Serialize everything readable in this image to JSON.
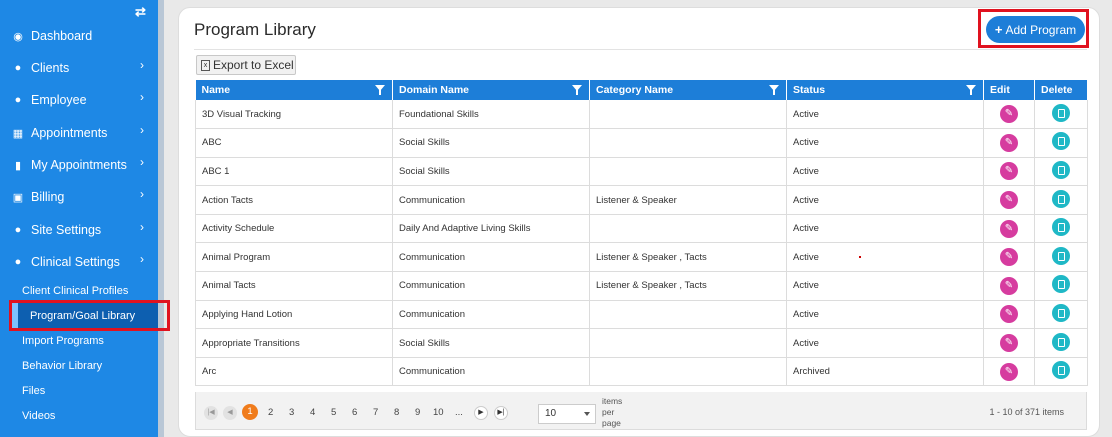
{
  "sidebar": {
    "items": [
      {
        "label": "Dashboard",
        "icon": "dashboard-icon",
        "glyph": "◉",
        "chevron": false
      },
      {
        "label": "Clients",
        "icon": "user-icon",
        "glyph": "●",
        "chevron": true
      },
      {
        "label": "Employee",
        "icon": "users-icon",
        "glyph": "●",
        "chevron": true
      },
      {
        "label": "Appointments",
        "icon": "calendar-icon",
        "glyph": "▦",
        "chevron": true
      },
      {
        "label": "My Appointments",
        "icon": "building-icon",
        "glyph": "▮",
        "chevron": true
      },
      {
        "label": "Billing",
        "icon": "money-icon",
        "glyph": "▣",
        "chevron": true
      },
      {
        "label": "Site Settings",
        "icon": "user-icon",
        "glyph": "●",
        "chevron": true
      },
      {
        "label": "Clinical Settings",
        "icon": "user-icon",
        "glyph": "●",
        "chevron": true
      }
    ],
    "sub_items": [
      "Client Clinical Profiles",
      "Program/Goal Library",
      "Import Programs",
      "Behavior Library",
      "Files",
      "Videos"
    ],
    "active_sub": "Program/Goal Library"
  },
  "header": {
    "title": "Program Library",
    "add_button": "Add Program",
    "export_button": "Export to Excel"
  },
  "table": {
    "columns": [
      "Name",
      "Domain Name",
      "Category Name",
      "Status",
      "Edit",
      "Delete"
    ],
    "rows": [
      {
        "name": "3D Visual Tracking",
        "domain": "Foundational Skills",
        "category": "",
        "status": "Active"
      },
      {
        "name": "ABC",
        "domain": "Social Skills",
        "category": "",
        "status": "Active"
      },
      {
        "name": "ABC 1",
        "domain": "Social Skills",
        "category": "",
        "status": "Active"
      },
      {
        "name": "Action Tacts",
        "domain": "Communication",
        "category": "Listener & Speaker",
        "status": "Active"
      },
      {
        "name": "Activity Schedule",
        "domain": "Daily And Adaptive Living Skills",
        "category": "",
        "status": "Active"
      },
      {
        "name": "Animal Program",
        "domain": "Communication",
        "category": "Listener & Speaker , Tacts",
        "status": "Active"
      },
      {
        "name": "Animal Tacts",
        "domain": "Communication",
        "category": "Listener & Speaker , Tacts",
        "status": "Active"
      },
      {
        "name": "Applying Hand Lotion",
        "domain": "Communication",
        "category": "",
        "status": "Active"
      },
      {
        "name": "Appropriate Transitions",
        "domain": "Social Skills",
        "category": "",
        "status": "Active"
      },
      {
        "name": "Arc",
        "domain": "Communication",
        "category": "",
        "status": "Archived"
      }
    ]
  },
  "pager": {
    "current": "1",
    "pages": [
      "2",
      "3",
      "4",
      "5",
      "6",
      "7",
      "8",
      "9",
      "10",
      "..."
    ],
    "page_size": "10",
    "size_label": "items per page",
    "info": "1 - 10 of 371 items"
  },
  "colors": {
    "sidebar": "#1e88e5",
    "accent": "#1d7ed8",
    "edit": "#d63c9f",
    "delete": "#1fb8c6",
    "current_page": "#f07c1c",
    "highlight": "#e0121f"
  }
}
